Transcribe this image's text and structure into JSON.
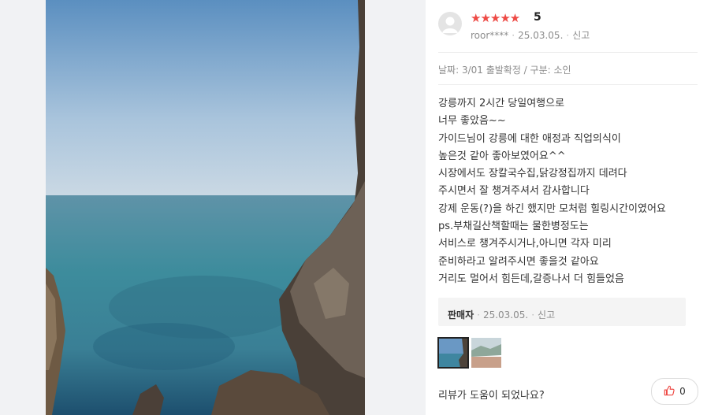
{
  "review": {
    "rating_stars": "★★★★★",
    "score": "5",
    "user": "roor****",
    "date": "25.03.05.",
    "report_label": "신고",
    "option_text": "날짜: 3/01 출발확정 / 구분: 소인",
    "body_lines": [
      "강릉까지 2시간 당일여행으로",
      "너무  좋았음~~",
      "가이드님이 강릉에 대한 애정과 직업의식이",
      "높은것 같아 좋아보였어요^^",
      "시장에서도  장칼국수집,닭강정집까지 데려다",
      "주시면서 잘 챙겨주셔서 감사합니다",
      "강제 운동(?)을  하긴 했지만 모처럼 힐링시간이였어요",
      "ps.부채길산책할때는  물한병정도는",
      "서비스로 챙겨주시거나,아니면 각자 미리",
      "준비하라고 알려주시면 좋을것  같아요",
      "거리도 멀어서 힘든데,갈증나서 더 힘들었음"
    ]
  },
  "seller_reply": {
    "label": "판매자",
    "date": "25.03.05.",
    "report_label": "신고"
  },
  "helpful": {
    "question": "리뷰가 도움이 되었나요?",
    "like_count": "0"
  },
  "colors": {
    "star": "#ee4a45",
    "text": "#333333",
    "muted": "#8c8c8c"
  },
  "icons": [
    "star-icon",
    "avatar-icon",
    "thumbs-up-icon"
  ]
}
